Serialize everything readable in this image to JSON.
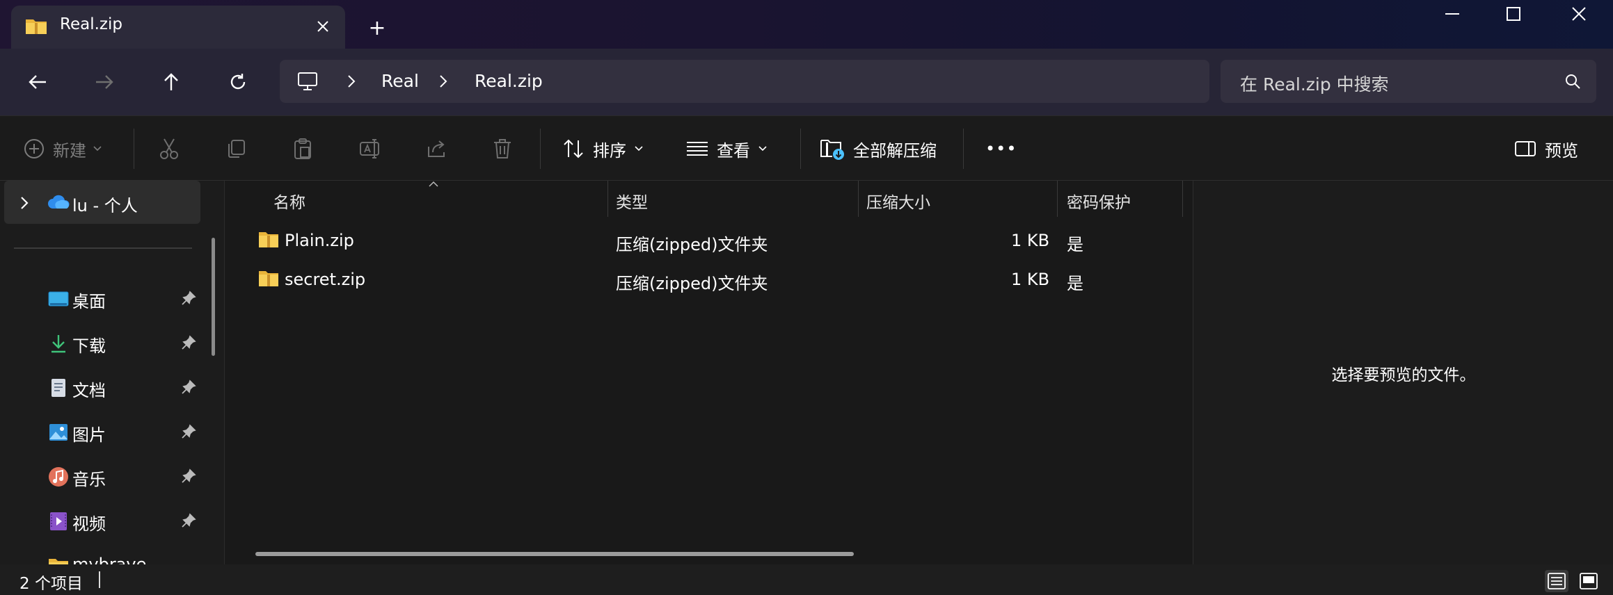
{
  "window": {
    "tab_title": "Real.zip",
    "new_tab_symbol": "+",
    "controls": [
      "minimize",
      "maximize",
      "close"
    ]
  },
  "nav": {
    "breadcrumb": [
      "Real",
      "Real.zip"
    ],
    "search_placeholder": "在 Real.zip 中搜索"
  },
  "toolbar": {
    "new_label": "新建",
    "sort_label": "排序",
    "view_label": "查看",
    "extract_all_label": "全部解压缩",
    "more_label": "•••",
    "preview_label": "预览",
    "icons": [
      "cut-icon",
      "copy-icon",
      "paste-icon",
      "rename-icon",
      "share-icon",
      "delete-icon"
    ]
  },
  "sidebar": {
    "onedrive_label": "lu - 个人",
    "items": [
      {
        "label": "桌面",
        "icon": "desktop-icon"
      },
      {
        "label": "下载",
        "icon": "download-icon"
      },
      {
        "label": "文档",
        "icon": "document-icon"
      },
      {
        "label": "图片",
        "icon": "pictures-icon"
      },
      {
        "label": "音乐",
        "icon": "music-icon"
      },
      {
        "label": "视频",
        "icon": "video-icon"
      },
      {
        "label": "mybrave",
        "icon": "folder-icon"
      }
    ]
  },
  "filelist": {
    "columns": [
      "名称",
      "类型",
      "压缩大小",
      "密码保护"
    ],
    "rows": [
      {
        "name": "Plain.zip",
        "type": "压缩(zipped)文件夹",
        "size": "1 KB",
        "protected": "是"
      },
      {
        "name": "secret.zip",
        "type": "压缩(zipped)文件夹",
        "size": "1 KB",
        "protected": "是"
      }
    ]
  },
  "preview": {
    "message": "选择要预览的文件。"
  },
  "status": {
    "item_count": "2 个项目"
  },
  "colors": {
    "accent": "#4cc2ff",
    "folder_yellow": "#f5c84a",
    "background": "#191919"
  }
}
